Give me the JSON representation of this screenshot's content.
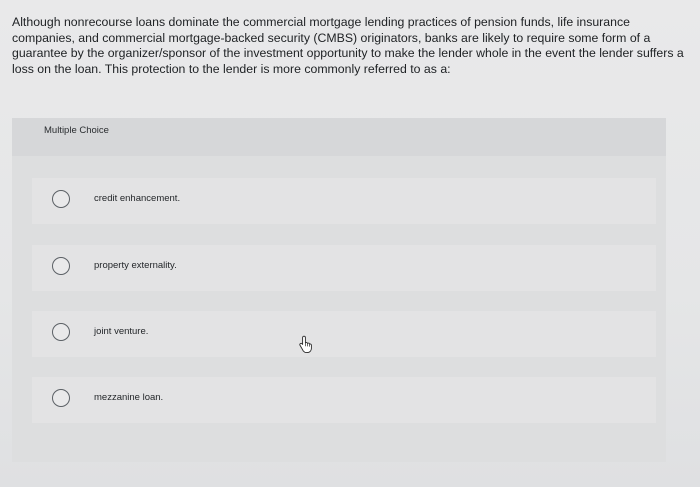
{
  "question": {
    "text": "Although nonrecourse loans dominate the commercial mortgage lending practices of pension funds, life insurance companies, and commercial mortgage-backed security (CMBS) originators, banks are likely to require some form of a guarantee by the organizer/sponsor of the investment opportunity to make the lender whole in the event the lender suffers a loss on the loan. This protection to the lender is more commonly referred to as a:"
  },
  "multiple_choice": {
    "header": "Multiple Choice",
    "options": [
      {
        "label": "credit enhancement."
      },
      {
        "label": "property externality."
      },
      {
        "label": "joint venture."
      },
      {
        "label": "mezzanine loan."
      }
    ]
  },
  "colors": {
    "panel": "#dddedf",
    "option_background": "#e3e3e4",
    "radio_border": "#5c6166",
    "text": "#24272a"
  },
  "icons": {
    "radio": "radio-button-unselected",
    "cursor": "hand-pointer-cursor"
  }
}
